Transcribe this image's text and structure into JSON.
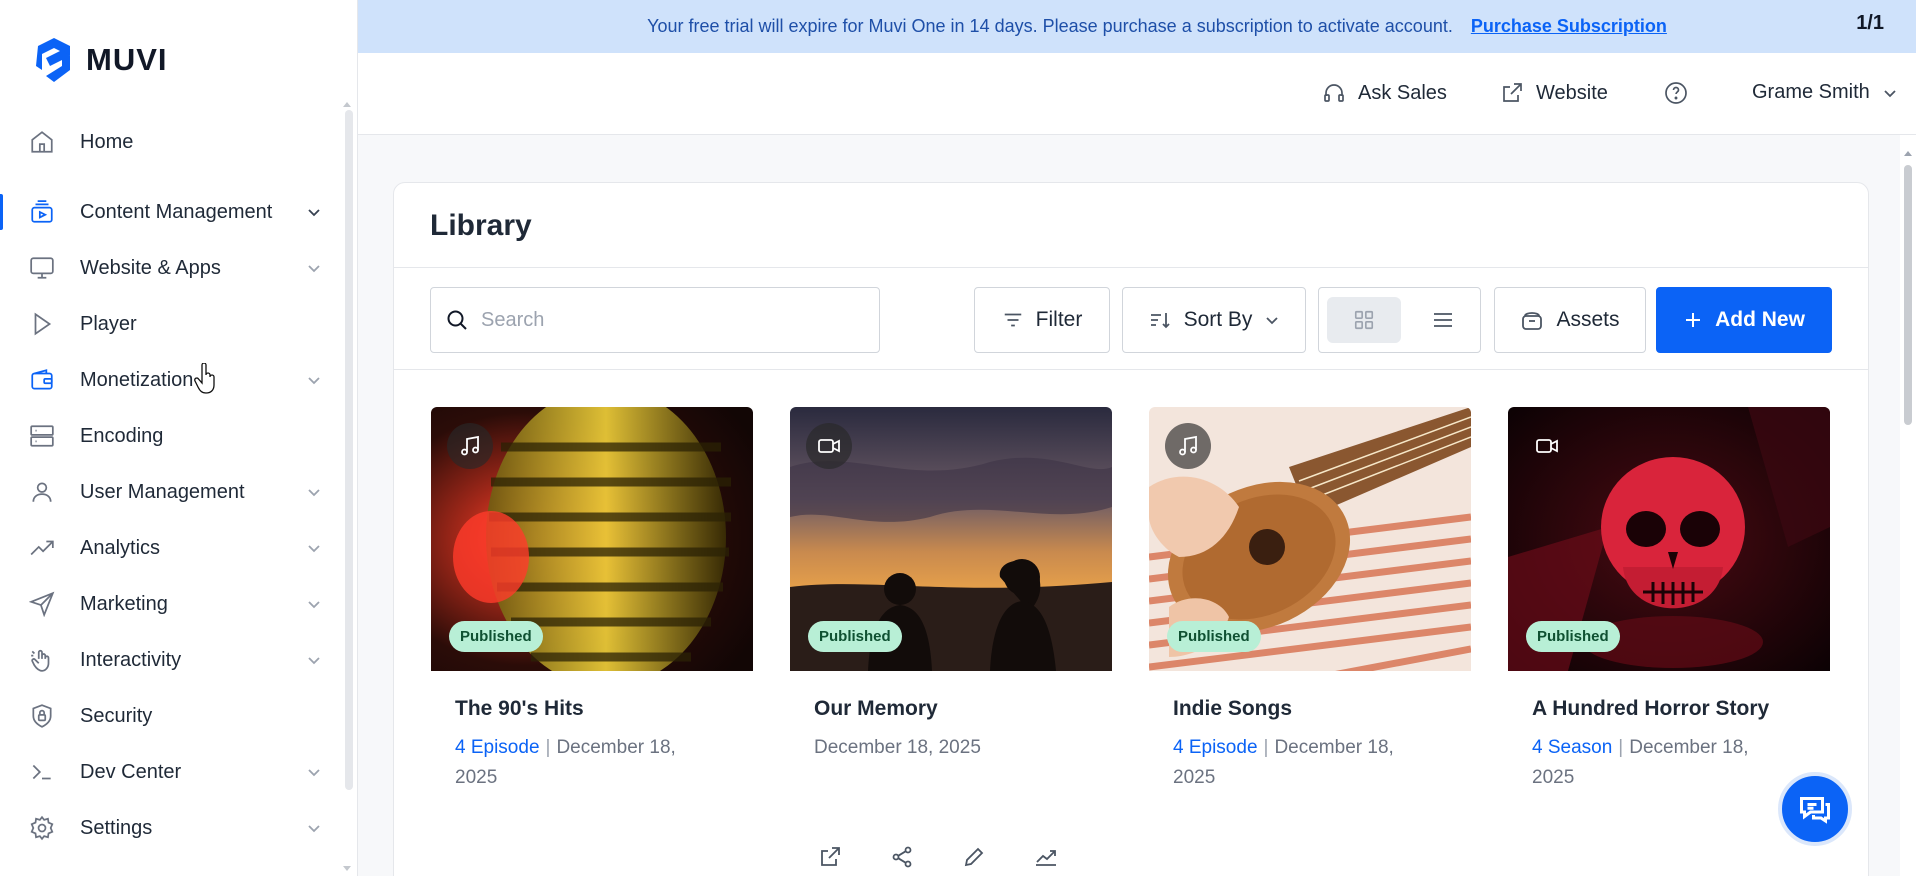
{
  "brand": {
    "name": "MUVI"
  },
  "banner": {
    "message": "Your free trial will expire for Muvi One in 14 days. Please purchase a subscription to activate account.",
    "link_label": "Purchase Subscription",
    "page_indicator": "1/1"
  },
  "topbar": {
    "ask_sales": "Ask Sales",
    "website": "Website",
    "user_name": "Grame Smith"
  },
  "sidebar": {
    "items": [
      {
        "label": "Home",
        "icon": "home-icon",
        "has_children": false
      },
      {
        "label": "Content Management",
        "icon": "content-icon",
        "has_children": true,
        "active": true
      },
      {
        "label": "Website & Apps",
        "icon": "monitor-icon",
        "has_children": true
      },
      {
        "label": "Player",
        "icon": "play-icon",
        "has_children": false
      },
      {
        "label": "Monetization",
        "icon": "wallet-icon",
        "has_children": true
      },
      {
        "label": "Encoding",
        "icon": "server-icon",
        "has_children": false
      },
      {
        "label": "User Management",
        "icon": "user-icon",
        "has_children": true
      },
      {
        "label": "Analytics",
        "icon": "trend-icon",
        "has_children": true
      },
      {
        "label": "Marketing",
        "icon": "send-icon",
        "has_children": true
      },
      {
        "label": "Interactivity",
        "icon": "hand-icon",
        "has_children": true
      },
      {
        "label": "Security",
        "icon": "shield-icon",
        "has_children": false
      },
      {
        "label": "Dev Center",
        "icon": "terminal-icon",
        "has_children": true
      },
      {
        "label": "Settings",
        "icon": "gear-icon",
        "has_children": true
      }
    ]
  },
  "library": {
    "title": "Library",
    "search_placeholder": "Search",
    "filter_label": "Filter",
    "sort_label": "Sort By",
    "assets_label": "Assets",
    "add_new_label": "Add New"
  },
  "tiles": [
    {
      "title": "The 90's Hits",
      "count": "4 Episode",
      "date_line1": "December 18,",
      "date_line2": "2025",
      "status": "Published",
      "media": "music-icon"
    },
    {
      "title": "Our Memory",
      "count": "",
      "date_line1": "December 18, 2025",
      "date_line2": "",
      "status": "Published",
      "media": "video-icon"
    },
    {
      "title": "Indie Songs",
      "count": "4 Episode",
      "date_line1": "December 18,",
      "date_line2": "2025",
      "status": "Published",
      "media": "music-icon"
    },
    {
      "title": "A Hundred Horror Story",
      "count": "4 Season",
      "date_line1": "December 18,",
      "date_line2": "2025",
      "status": "Published",
      "media": "video-icon"
    }
  ],
  "colors": {
    "accent": "#0b63f6",
    "banner_bg": "#cfe2fb",
    "published_bg": "#b8efd6"
  }
}
